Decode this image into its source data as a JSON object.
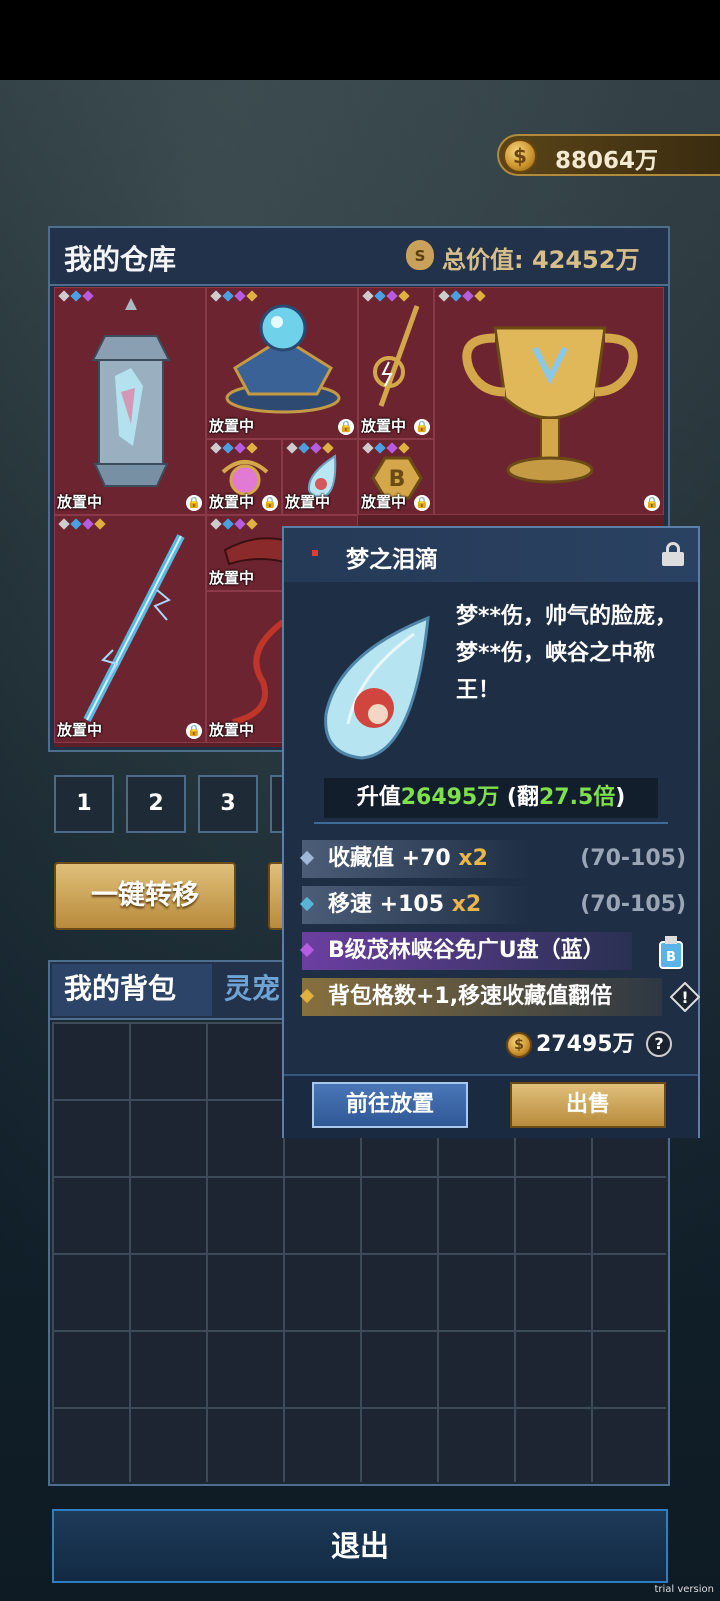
{
  "currency": {
    "amount": "88064万"
  },
  "warehouse": {
    "title": "我的仓库",
    "total_label": "总价值: 42452万",
    "placed_label": "放置中"
  },
  "pages": [
    "1",
    "2",
    "3"
  ],
  "buttons": {
    "transfer": "一键转移",
    "exit": "退出"
  },
  "backpack": {
    "tab_active": "我的背包",
    "tab_other": "灵宠"
  },
  "popup": {
    "name": "梦之泪滴",
    "description": "梦**伤，帅气的脸庞，梦**伤，峡谷之中称王！",
    "upvalue_prefix": "升值",
    "upvalue_amount": "26495万",
    "upvalue_mid": " (翻",
    "upvalue_mult": "27.5倍",
    "upvalue_suffix": ")",
    "stats": [
      {
        "text": "收藏值 +70",
        "mult": "x2",
        "range": "(70-105)"
      },
      {
        "text": "移速 +105",
        "mult": "x2",
        "range": "(70-105)"
      },
      {
        "text": "B级茂林峡谷免广U盘（蓝）"
      },
      {
        "text": "背包格数+1,移速收藏值翻倍"
      }
    ],
    "price": "27495万",
    "help": "?",
    "goto_button": "前往放置",
    "sell_button": "出售"
  },
  "watermark": "trial version",
  "colors": {
    "accent_gold": "#e0c07a",
    "accent_green": "#7ee04a",
    "cell_red": "#6b2430"
  }
}
